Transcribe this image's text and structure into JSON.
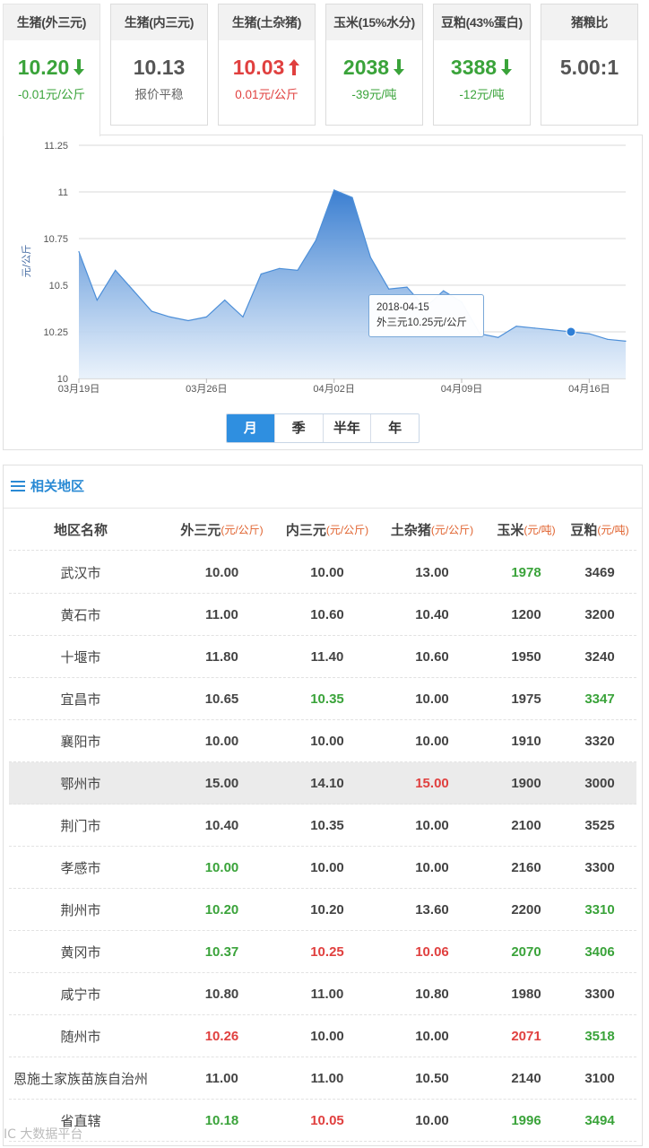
{
  "cards": [
    {
      "title": "生猪(外三元)",
      "value": "10.20",
      "trend": "down",
      "change": "-0.01元/公斤",
      "color": "green"
    },
    {
      "title": "生猪(内三元)",
      "value": "10.13",
      "trend": "flat",
      "change": "报价平稳",
      "color": "gray"
    },
    {
      "title": "生猪(土杂猪)",
      "value": "10.03",
      "trend": "up",
      "change": "0.01元/公斤",
      "color": "red"
    },
    {
      "title": "玉米(15%水分)",
      "value": "2038",
      "trend": "down",
      "change": "-39元/吨",
      "color": "green"
    },
    {
      "title": "豆粕(43%蛋白)",
      "value": "3388",
      "trend": "down",
      "change": "-12元/吨",
      "color": "green"
    },
    {
      "title": "猪粮比",
      "value": "5.00:1",
      "trend": "none",
      "change": "",
      "color": "gray"
    }
  ],
  "chart_data": {
    "type": "area",
    "ylabel": "元/公斤",
    "ylim": [
      10,
      11.25
    ],
    "yticks": [
      "11.25",
      "11",
      "10.75",
      "10.5",
      "10.25",
      "10"
    ],
    "xticks": [
      "03月19日",
      "03月26日",
      "04月02日",
      "04月09日",
      "04月16日"
    ],
    "x": [
      "03-19",
      "03-20",
      "03-21",
      "03-22",
      "03-23",
      "03-24",
      "03-25",
      "03-26",
      "03-27",
      "03-28",
      "03-29",
      "03-30",
      "03-31",
      "04-01",
      "04-02",
      "04-03",
      "04-04",
      "04-05",
      "04-06",
      "04-07",
      "04-08",
      "04-09",
      "04-10",
      "04-11",
      "04-12",
      "04-13",
      "04-14",
      "04-15",
      "04-16",
      "04-17",
      "04-18"
    ],
    "series": [
      {
        "values": [
          10.68,
          10.42,
          10.58,
          10.47,
          10.36,
          10.33,
          10.31,
          10.33,
          10.42,
          10.33,
          10.56,
          10.59,
          10.58,
          10.74,
          11.01,
          10.97,
          10.65,
          10.48,
          10.49,
          10.38,
          10.47,
          10.41,
          10.24,
          10.22,
          10.28,
          10.27,
          10.26,
          10.25,
          10.24,
          10.21,
          10.2
        ]
      }
    ],
    "grid": true,
    "tooltip": {
      "date": "2018-04-15",
      "label": "外三元10.25元/公斤"
    }
  },
  "range_buttons": [
    "月",
    "季",
    "半年",
    "年"
  ],
  "range_active": "月",
  "region": {
    "title": "相关地区",
    "headers": [
      {
        "name": "地区名称",
        "unit": ""
      },
      {
        "name": "外三元",
        "unit": "(元/公斤)"
      },
      {
        "name": "内三元",
        "unit": "(元/公斤)"
      },
      {
        "name": "土杂猪",
        "unit": "(元/公斤)"
      },
      {
        "name": "玉米",
        "unit": "(元/吨)"
      },
      {
        "name": "豆粕",
        "unit": "(元/吨)"
      }
    ],
    "rows": [
      {
        "name": "武汉市",
        "cells": [
          [
            "10.00",
            "n"
          ],
          [
            "10.00",
            "n"
          ],
          [
            "13.00",
            "n"
          ],
          [
            "1978",
            "g"
          ],
          [
            "3469",
            "n"
          ]
        ]
      },
      {
        "name": "黄石市",
        "cells": [
          [
            "11.00",
            "n"
          ],
          [
            "10.60",
            "n"
          ],
          [
            "10.40",
            "n"
          ],
          [
            "1200",
            "n"
          ],
          [
            "3200",
            "n"
          ]
        ]
      },
      {
        "name": "十堰市",
        "cells": [
          [
            "11.80",
            "n"
          ],
          [
            "11.40",
            "n"
          ],
          [
            "10.60",
            "n"
          ],
          [
            "1950",
            "n"
          ],
          [
            "3240",
            "n"
          ]
        ]
      },
      {
        "name": "宜昌市",
        "cells": [
          [
            "10.65",
            "n"
          ],
          [
            "10.35",
            "g"
          ],
          [
            "10.00",
            "n"
          ],
          [
            "1975",
            "n"
          ],
          [
            "3347",
            "g"
          ]
        ]
      },
      {
        "name": "襄阳市",
        "cells": [
          [
            "10.00",
            "n"
          ],
          [
            "10.00",
            "n"
          ],
          [
            "10.00",
            "n"
          ],
          [
            "1910",
            "n"
          ],
          [
            "3320",
            "n"
          ]
        ]
      },
      {
        "name": "鄂州市",
        "cells": [
          [
            "15.00",
            "n"
          ],
          [
            "14.10",
            "n"
          ],
          [
            "15.00",
            "r"
          ],
          [
            "1900",
            "n"
          ],
          [
            "3000",
            "n"
          ]
        ]
      },
      {
        "name": "荆门市",
        "cells": [
          [
            "10.40",
            "n"
          ],
          [
            "10.35",
            "n"
          ],
          [
            "10.00",
            "n"
          ],
          [
            "2100",
            "n"
          ],
          [
            "3525",
            "n"
          ]
        ]
      },
      {
        "name": "孝感市",
        "cells": [
          [
            "10.00",
            "g"
          ],
          [
            "10.00",
            "n"
          ],
          [
            "10.00",
            "n"
          ],
          [
            "2160",
            "n"
          ],
          [
            "3300",
            "n"
          ]
        ]
      },
      {
        "name": "荆州市",
        "cells": [
          [
            "10.20",
            "g"
          ],
          [
            "10.20",
            "n"
          ],
          [
            "13.60",
            "n"
          ],
          [
            "2200",
            "n"
          ],
          [
            "3310",
            "g"
          ]
        ]
      },
      {
        "name": "黄冈市",
        "cells": [
          [
            "10.37",
            "g"
          ],
          [
            "10.25",
            "r"
          ],
          [
            "10.06",
            "r"
          ],
          [
            "2070",
            "g"
          ],
          [
            "3406",
            "g"
          ]
        ]
      },
      {
        "name": "咸宁市",
        "cells": [
          [
            "10.80",
            "n"
          ],
          [
            "11.00",
            "n"
          ],
          [
            "10.80",
            "n"
          ],
          [
            "1980",
            "n"
          ],
          [
            "3300",
            "n"
          ]
        ]
      },
      {
        "name": "随州市",
        "cells": [
          [
            "10.26",
            "r"
          ],
          [
            "10.00",
            "n"
          ],
          [
            "10.00",
            "n"
          ],
          [
            "2071",
            "r"
          ],
          [
            "3518",
            "g"
          ]
        ]
      },
      {
        "name": "恩施土家族苗族自治州",
        "cells": [
          [
            "11.00",
            "n"
          ],
          [
            "11.00",
            "n"
          ],
          [
            "10.50",
            "n"
          ],
          [
            "2140",
            "n"
          ],
          [
            "3100",
            "n"
          ]
        ]
      },
      {
        "name": "省直辖",
        "cells": [
          [
            "10.18",
            "g"
          ],
          [
            "10.05",
            "r"
          ],
          [
            "10.00",
            "n"
          ],
          [
            "1996",
            "g"
          ],
          [
            "3494",
            "g"
          ]
        ]
      }
    ],
    "highlight_row": "鄂州市"
  },
  "watermark": "IC 大数据平台",
  "colors": {
    "accent": "#2f8fe0",
    "green": "#3aa33a",
    "red": "#e0403f",
    "area_top": "#3b7fd1",
    "area_bottom": "#e8f1fb"
  }
}
